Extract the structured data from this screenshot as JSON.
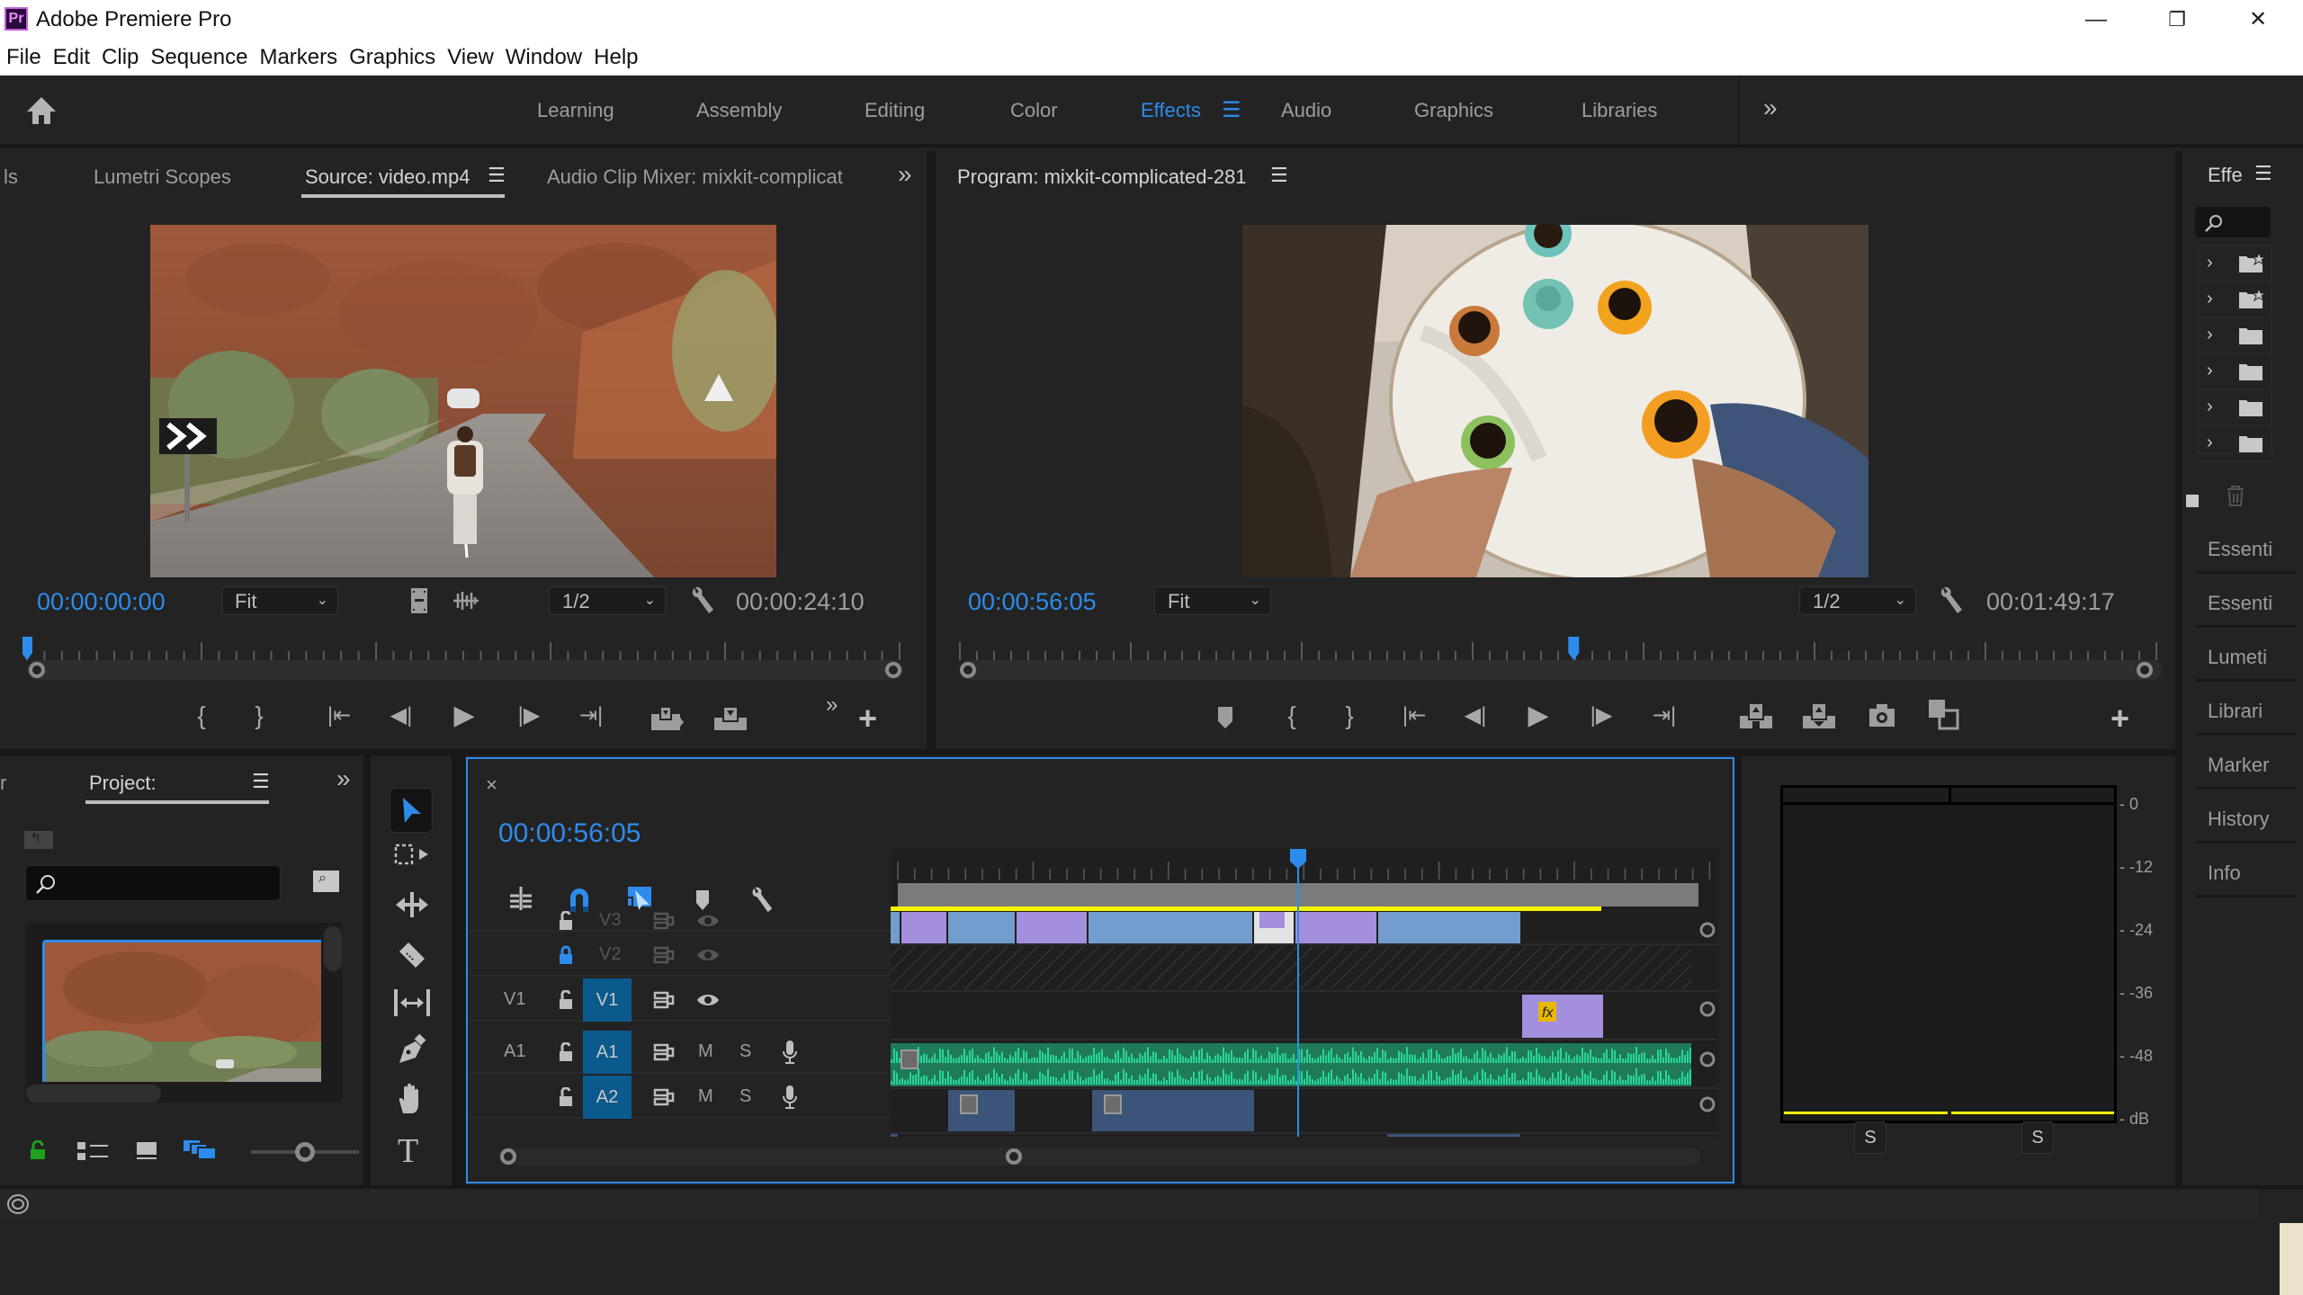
{
  "app": {
    "title": "Adobe Premiere Pro",
    "logo_text": "Pr",
    "window_controls": {
      "minimize": "—",
      "restore": "❐",
      "close": "✕"
    }
  },
  "menu": [
    "File",
    "Edit",
    "Clip",
    "Sequence",
    "Markers",
    "Graphics",
    "View",
    "Window",
    "Help"
  ],
  "workspaces": {
    "tabs": [
      {
        "label": "Learning",
        "active": false
      },
      {
        "label": "Assembly",
        "active": false
      },
      {
        "label": "Editing",
        "active": false
      },
      {
        "label": "Color",
        "active": false
      },
      {
        "label": "Effects",
        "active": true
      },
      {
        "label": "Audio",
        "active": false
      },
      {
        "label": "Graphics",
        "active": false
      },
      {
        "label": "Libraries",
        "active": false
      }
    ],
    "overflow": "»",
    "accent": "#2d8ceb"
  },
  "source_panel": {
    "tabs": [
      {
        "label": "ls",
        "active": false
      },
      {
        "label": "Lumetri Scopes",
        "active": false
      },
      {
        "label": "Source: video.mp4",
        "active": true
      },
      {
        "label": "Audio Clip Mixer: mixkit-complicat",
        "active": false
      }
    ],
    "overflow": "»",
    "timecode_current": "00:00:00:00",
    "zoom": "Fit",
    "resolution": "1/2",
    "timecode_duration": "00:00:24:10",
    "playhead_fraction": 0.0
  },
  "program_panel": {
    "title": "Program: mixkit-complicated-281",
    "timecode_current": "00:00:56:05",
    "zoom": "Fit",
    "resolution": "1/2",
    "timecode_duration": "00:01:49:17",
    "playhead_fraction": 0.513
  },
  "effects_panel": {
    "title": "Effe",
    "search_placeholder": "",
    "folders": [
      {
        "type": "star-folder"
      },
      {
        "type": "star-folder"
      },
      {
        "type": "folder"
      },
      {
        "type": "folder"
      },
      {
        "type": "folder"
      },
      {
        "type": "folder"
      }
    ],
    "side_tabs": [
      "Essenti",
      "Essenti",
      "Lumeti",
      "Librari",
      "Marker",
      "History",
      "Info"
    ]
  },
  "project_panel": {
    "prefix_tab": "r",
    "title": "Project:",
    "search_placeholder": "",
    "overflow": "»"
  },
  "timeline": {
    "close": "×",
    "timecode": "00:00:56:05",
    "playhead_fraction": 0.5,
    "tracks": {
      "video": [
        {
          "name": "V3",
          "locked": false,
          "target": false
        },
        {
          "name": "V2",
          "locked": true,
          "target": false
        },
        {
          "name": "V1",
          "source": "V1",
          "locked": false,
          "target": true
        }
      ],
      "audio": [
        {
          "name": "A1",
          "source": "A1",
          "locked": false,
          "target": true,
          "mute": "M",
          "solo": "S"
        },
        {
          "name": "A2",
          "locked": false,
          "target": true,
          "mute": "M",
          "solo": "S"
        }
      ]
    },
    "colors": {
      "video_clip_blue": "#739ccf",
      "video_clip_violet": "#a48ede",
      "audio_clip_green": "#1f7a57",
      "audio_wave": "#2ad598",
      "audio_clip_blue": "#3c5478",
      "render_bar_yellow": "#f5f500",
      "playhead": "#2d8ceb"
    },
    "fx_label": "fx"
  },
  "audio_meter": {
    "scale": [
      "0",
      "-12",
      "-24",
      "-36",
      "-48",
      "dB"
    ],
    "solo_buttons": [
      "S",
      "S"
    ]
  }
}
